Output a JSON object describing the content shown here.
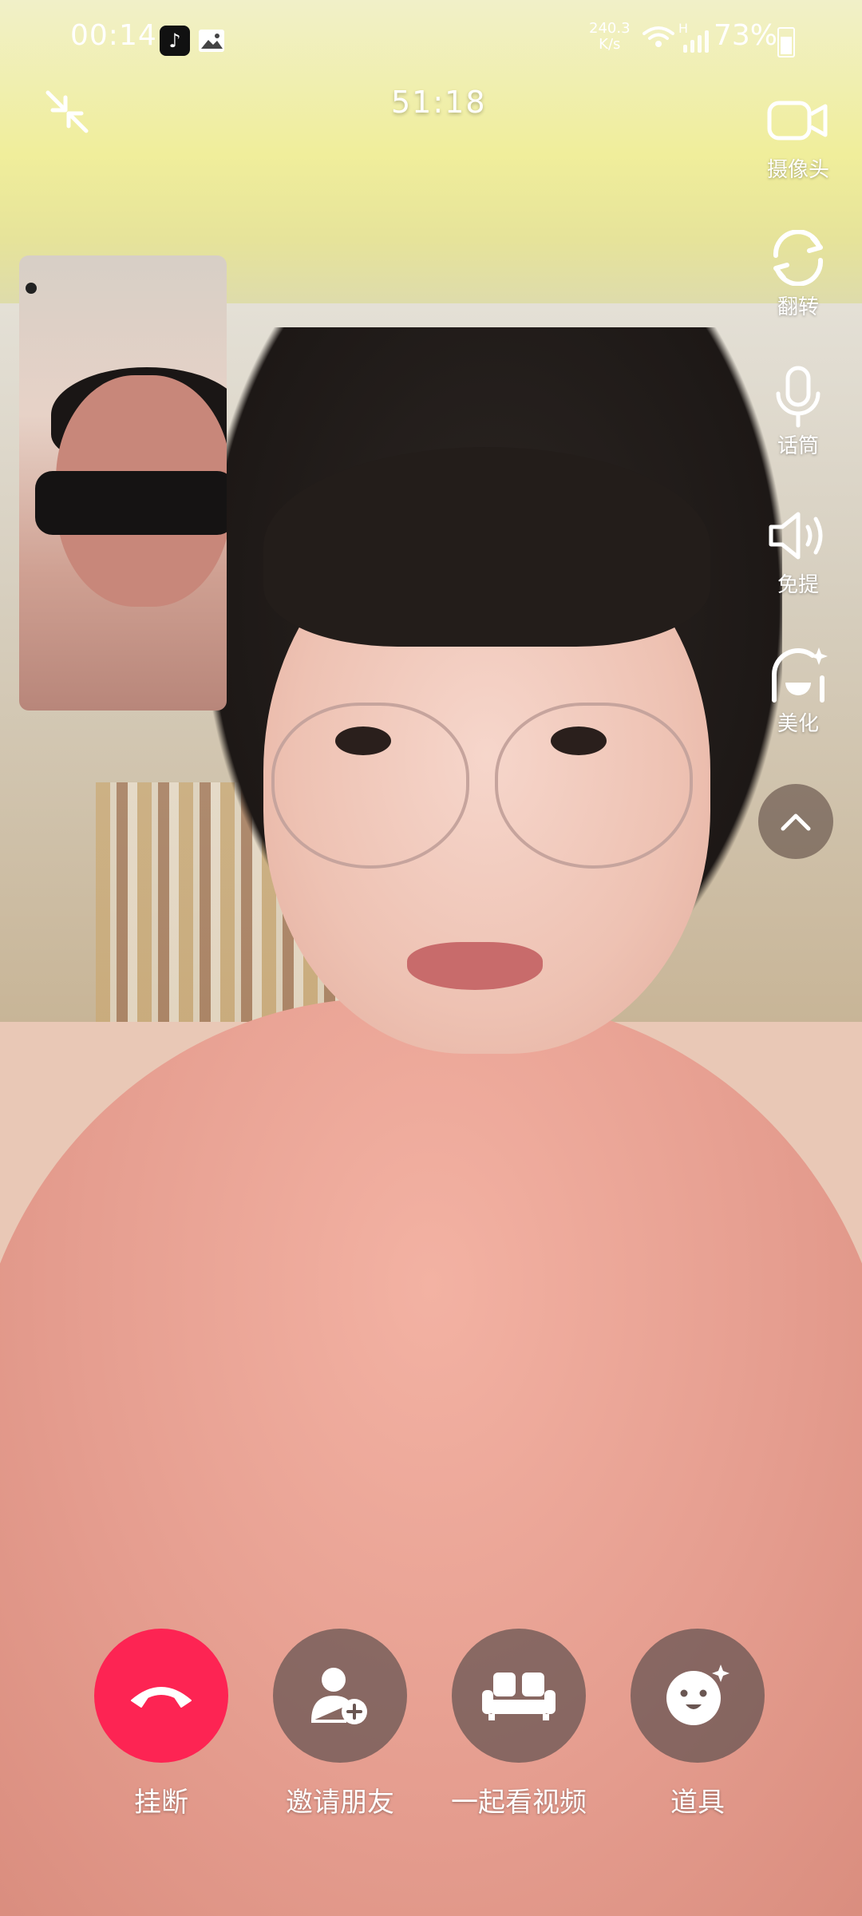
{
  "status_bar": {
    "time": "00:14",
    "net_speed_value": "240.3",
    "net_speed_unit": "K/s",
    "signal_type": "H",
    "battery": "73%",
    "notification_icons": [
      "tiktok-icon",
      "image-icon"
    ]
  },
  "call": {
    "timer": "51:18"
  },
  "tools": [
    {
      "label": "摄像头",
      "icon": "camera-icon"
    },
    {
      "label": "翻转",
      "icon": "flip-camera-icon"
    },
    {
      "label": "话筒",
      "icon": "microphone-icon"
    },
    {
      "label": "免提",
      "icon": "speaker-icon"
    },
    {
      "label": "美化",
      "icon": "beautify-icon"
    }
  ],
  "actions": [
    {
      "label": "挂断",
      "icon": "hang-up-icon",
      "color": "#fd2453"
    },
    {
      "label": "邀请朋友",
      "icon": "invite-friend-icon"
    },
    {
      "label": "一起看视频",
      "icon": "watch-together-icon"
    },
    {
      "label": "道具",
      "icon": "props-icon"
    }
  ]
}
